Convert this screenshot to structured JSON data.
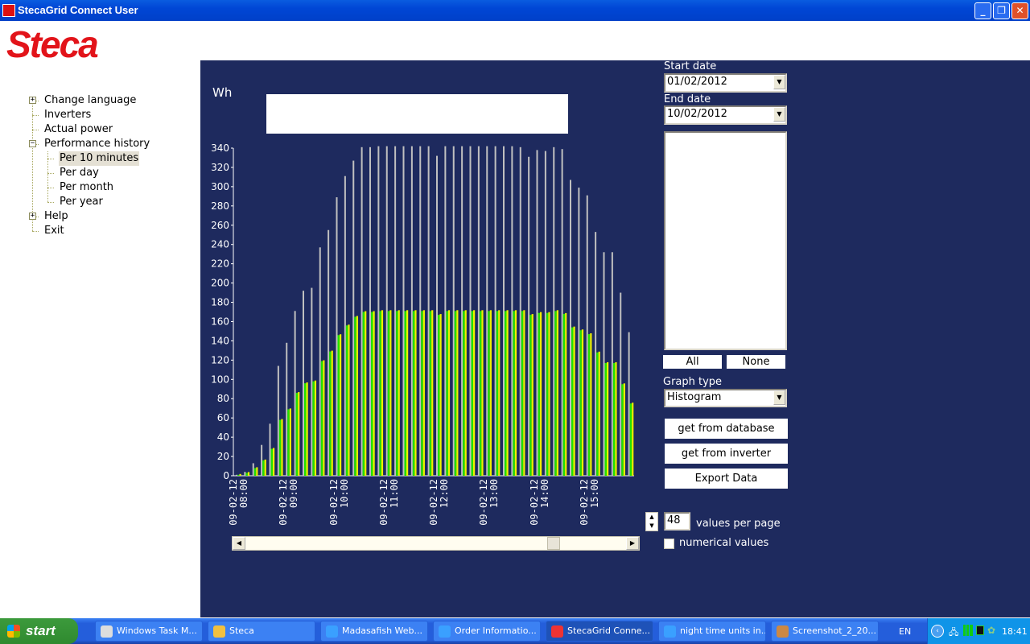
{
  "window": {
    "title": "StecaGrid Connect User",
    "logo_text": "Steca",
    "app_icon_text": "Steca Grid"
  },
  "tree": {
    "items": [
      {
        "label": "Change language",
        "expander": "+"
      },
      {
        "label": "Inverters"
      },
      {
        "label": "Actual power"
      },
      {
        "label": "Performance history",
        "expander": "−"
      },
      {
        "label": "Per 10 minutes",
        "selected": true
      },
      {
        "label": "Per day"
      },
      {
        "label": "Per month"
      },
      {
        "label": "Per year"
      },
      {
        "label": "Help",
        "expander": "+"
      },
      {
        "label": "Exit"
      }
    ]
  },
  "panel": {
    "start_date_label": "Start date",
    "start_date": "01/02/2012",
    "end_date_label": "End date",
    "end_date": "10/02/2012",
    "all_label": "All",
    "none_label": "None",
    "graph_type_label": "Graph type",
    "graph_type": "Histogram",
    "get_db_label": "get from database",
    "get_inv_label": "get from inverter",
    "export_label": "Export Data",
    "values_per_page": "48",
    "values_per_page_label": "values per page",
    "numerical_label": "numerical values",
    "numerical_checked": false
  },
  "chart_data": {
    "type": "bar",
    "ylabel": "Wh",
    "ylim": [
      0,
      340
    ],
    "yticks": [
      0,
      20,
      40,
      60,
      80,
      100,
      120,
      140,
      160,
      180,
      200,
      220,
      240,
      260,
      280,
      300,
      320,
      340
    ],
    "xtick_labels": [
      {
        "index": 0,
        "date": "09-02-12",
        "time": "08:00"
      },
      {
        "index": 6,
        "date": "09-02-12",
        "time": "09:00"
      },
      {
        "index": 12,
        "date": "09-02-12",
        "time": "10:00"
      },
      {
        "index": 18,
        "date": "09-02-12",
        "time": "11:00"
      },
      {
        "index": 24,
        "date": "09-02-12",
        "time": "12:00"
      },
      {
        "index": 30,
        "date": "09-02-12",
        "time": "13:00"
      },
      {
        "index": 36,
        "date": "09-02-12",
        "time": "14:00"
      },
      {
        "index": 42,
        "date": "09-02-12",
        "time": "15:00"
      }
    ],
    "series": [
      {
        "color": "#c0c0c0",
        "values": [
          1,
          4,
          13,
          32,
          54,
          114,
          138,
          171,
          192,
          195,
          237,
          255,
          289,
          311,
          327,
          341,
          341,
          342,
          342,
          342,
          342,
          342,
          342,
          342,
          332,
          342,
          342,
          342,
          342,
          342,
          342,
          342,
          342,
          342,
          341,
          331,
          338,
          337,
          341,
          339,
          307,
          299,
          291,
          253,
          232,
          232,
          190,
          149
        ]
      },
      {
        "color": "#22e000",
        "color2": "#f0f000",
        "values": [
          1,
          3,
          8,
          16,
          28,
          58,
          69,
          86,
          96,
          98,
          119,
          129,
          146,
          156,
          165,
          170,
          170,
          171,
          171,
          171,
          171,
          171,
          171,
          171,
          167,
          171,
          171,
          171,
          171,
          171,
          171,
          171,
          171,
          171,
          171,
          167,
          169,
          169,
          171,
          168,
          154,
          151,
          147,
          128,
          117,
          117,
          95,
          75
        ]
      }
    ]
  },
  "scrollbar": {
    "position": 0.82
  },
  "taskbar": {
    "start_label": "start",
    "buttons": [
      {
        "label": "Windows Task M...",
        "icon": "monitor-icon"
      },
      {
        "label": "Steca",
        "icon": "folder-icon"
      },
      {
        "label": "Madasafish Web...",
        "icon": "ie-icon"
      },
      {
        "label": "Order Informatio...",
        "icon": "ie-icon"
      },
      {
        "label": "StecaGrid Conne...",
        "icon": "steca-icon",
        "active": true
      },
      {
        "label": "night time units in...",
        "icon": "ie-icon"
      },
      {
        "label": "Screenshot_2_20...",
        "icon": "paint-icon"
      }
    ],
    "lang": "EN",
    "clock": "18:41"
  }
}
